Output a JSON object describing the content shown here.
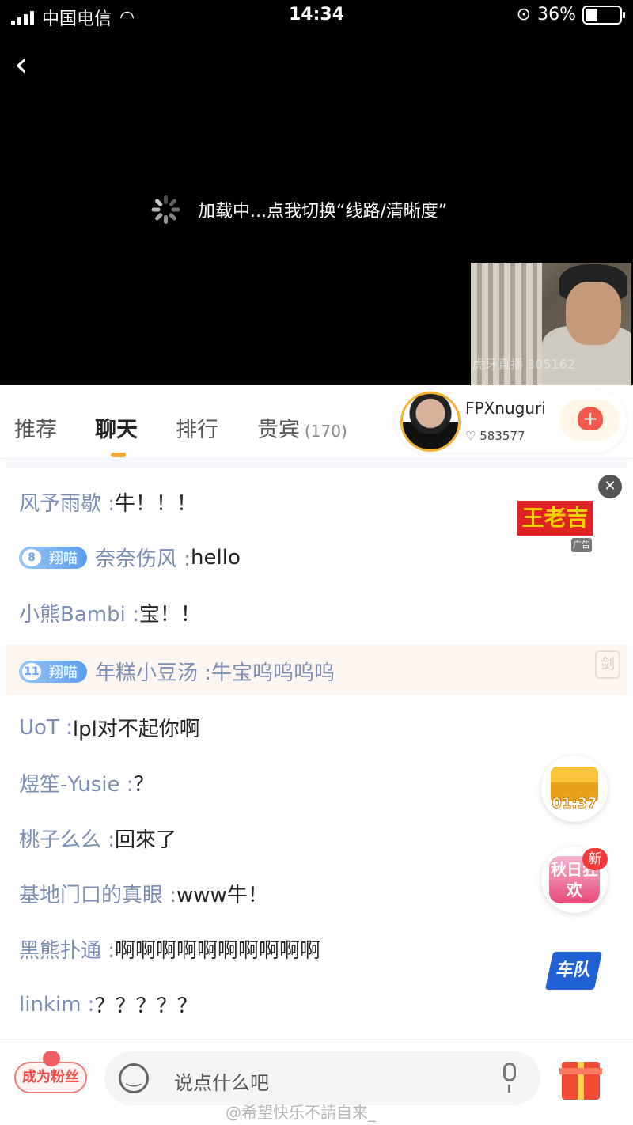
{
  "status_bar": {
    "carrier": "中国电信",
    "time": "14:34",
    "battery": "36%",
    "battery_level": 0.36
  },
  "player": {
    "loading_text": "加载中...点我切换“线路/清晰度”",
    "pip_watermark": "虎牙直播 305162"
  },
  "tabs": [
    {
      "label": "推荐"
    },
    {
      "label": "聊天"
    },
    {
      "label": "排行"
    },
    {
      "label": "贵宾",
      "count": "(170)"
    }
  ],
  "anchor": {
    "name": "FPXnuguri",
    "likes": "583577"
  },
  "messages": [
    {
      "user": "风予雨歇 : ",
      "text": "牛！！！"
    },
    {
      "badge_level": "8",
      "badge_name": "翔喵",
      "user": "奈奈伤风 : ",
      "text": "hello"
    },
    {
      "user": "小熊Bambi : ",
      "text": "宝！！"
    },
    {
      "badge_level": "11",
      "badge_name": "翔喵",
      "user": "年糕小豆汤 : ",
      "text": "牛宝呜呜呜呜"
    },
    {
      "user": "UoT : ",
      "text": "lpl对不起你啊"
    },
    {
      "user": "煜笙-Yusie : ",
      "text": "？"
    },
    {
      "user": "桃子么么 : ",
      "text": "回來了"
    },
    {
      "user": "基地门口的真眼 : ",
      "text": "www牛！"
    },
    {
      "user": "黑熊扑通 : ",
      "text": "啊啊啊啊啊啊啊啊啊啊"
    },
    {
      "user": "linkim : ",
      "text": "？？？？？"
    }
  ],
  "ad": {
    "brand": "王老吉",
    "tag": "广告"
  },
  "floats": {
    "chest_timer": "01:37",
    "festival": "秋日狂欢",
    "new_tag": "新",
    "team": "车队",
    "sword": "剑"
  },
  "bottom": {
    "fan_label": "成为粉丝",
    "input_placeholder": "说点什么吧"
  },
  "watermark": "@希望快乐不請自来_"
}
